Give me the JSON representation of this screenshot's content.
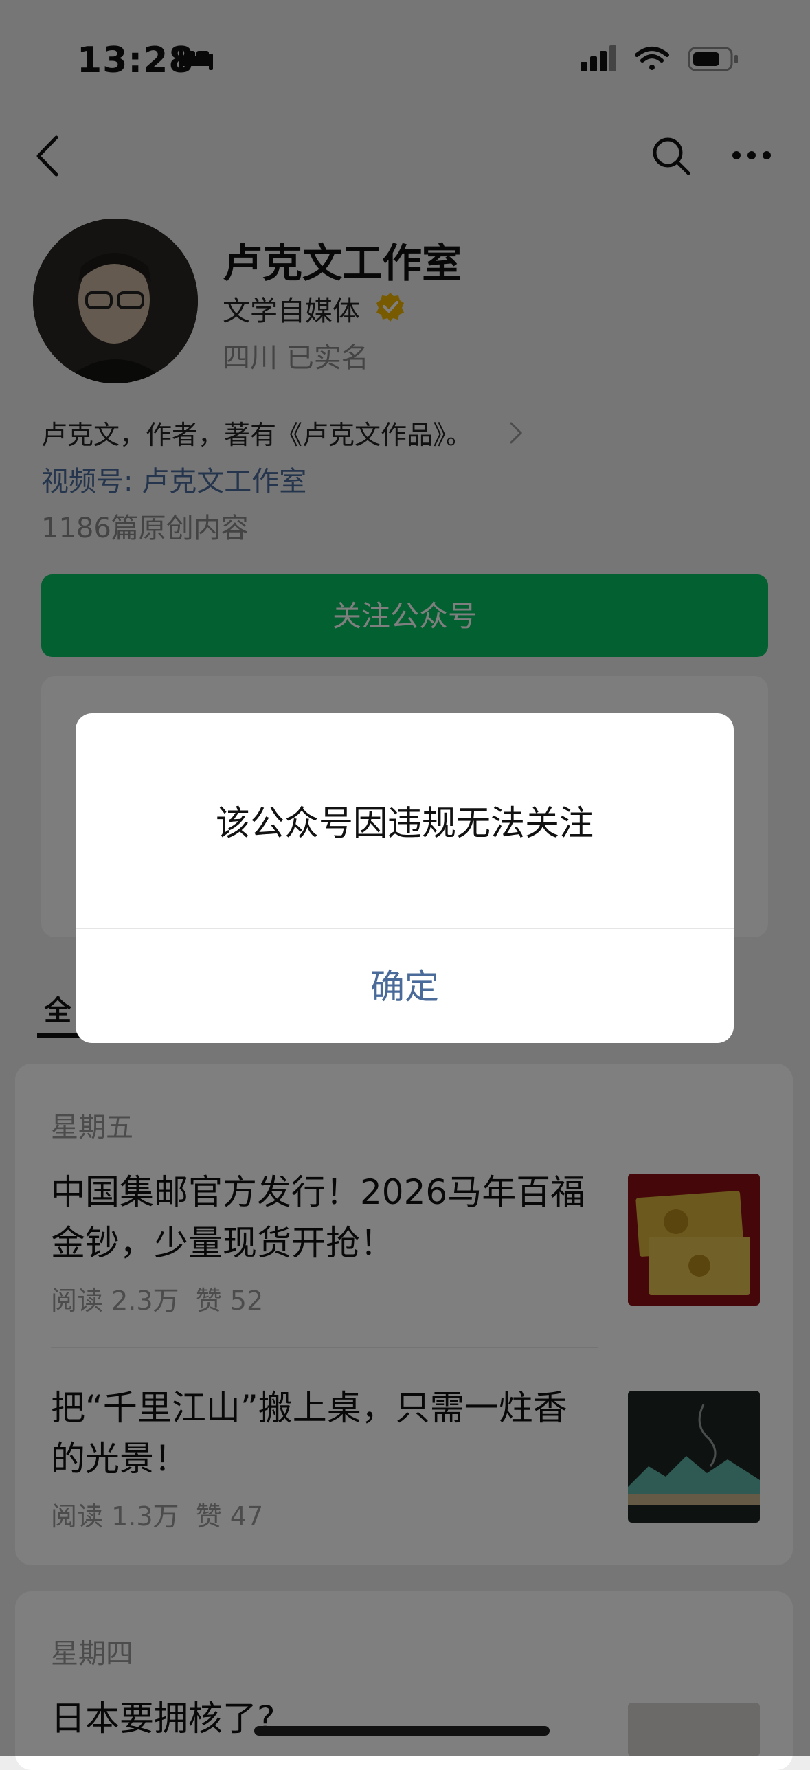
{
  "status_bar": {
    "time": "13:28"
  },
  "profile": {
    "name": "卢克文工作室",
    "category": "文学自媒体",
    "location": "四川 已实名",
    "bio": "卢克文，作者，著有《卢克文作品》。",
    "video_account": "视频号: 卢克文工作室",
    "original_count": "1186篇原创内容",
    "follow_button": "关注公众号"
  },
  "tabs": {
    "all": "全"
  },
  "articles": [
    {
      "day": "星期五",
      "items": [
        {
          "title": "中国集邮官方发行！2026马年百福金钞，少量现货开抢！",
          "reads": "阅读 2.3万",
          "likes": "赞 52"
        },
        {
          "title": "把“千里江山”搬上桌，只需一炷香的光景！",
          "reads": "阅读 1.3万",
          "likes": "赞 47"
        }
      ]
    },
    {
      "day": "星期四",
      "items": [
        {
          "title": "日本要拥核了?"
        }
      ]
    }
  ],
  "dialog": {
    "message": "该公众号因违规无法关注",
    "confirm": "确定"
  },
  "colors": {
    "accent_green": "#07c160",
    "link_blue": "#4a6b9a",
    "verified_gold": "#f0b400"
  }
}
